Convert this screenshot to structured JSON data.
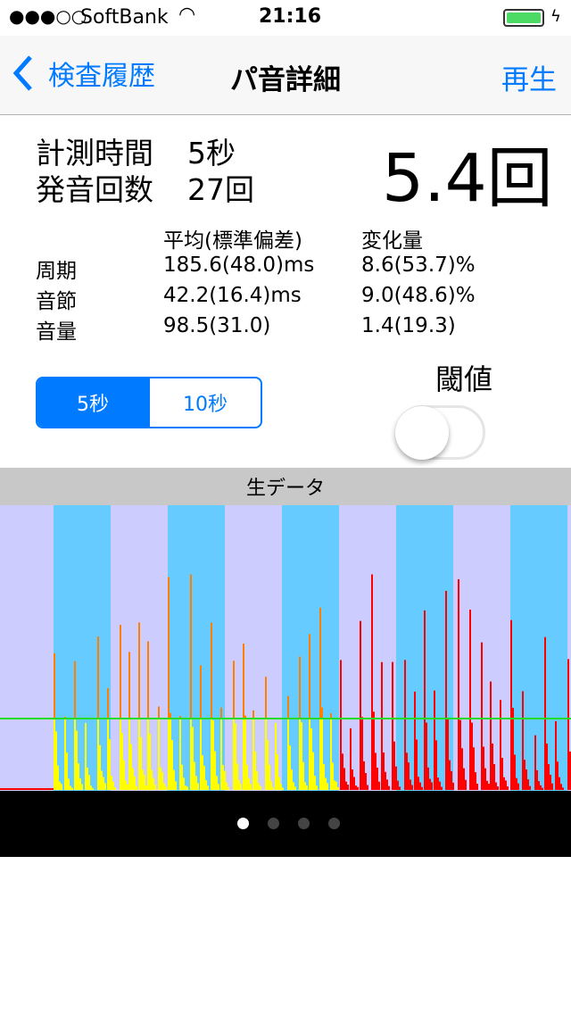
{
  "status_bar": {
    "carrier": "SoftBank",
    "signal_dots": "●●●○○",
    "time": "21:16",
    "battery_level_percent": 100
  },
  "nav": {
    "back_label": "検査履歴",
    "title": "パ音詳細",
    "play_label": "再生"
  },
  "summary": {
    "duration_label": "計測時間",
    "duration_value": "5秒",
    "count_label": "発音回数",
    "count_value": "27回",
    "rate": "5.4回"
  },
  "table": {
    "headers": [
      "",
      "平均(標準偏差)",
      "変化量"
    ],
    "rows": [
      {
        "label": "周期",
        "mean": "185.6(48.0)ms",
        "change": "8.6(53.7)%"
      },
      {
        "label": "音節",
        "mean": "42.2(16.4)ms",
        "change": "9.0(48.6)%"
      },
      {
        "label": "音量",
        "mean": "98.5(31.0)",
        "change": "1.4(19.3)"
      }
    ]
  },
  "segment": {
    "options": [
      "5秒",
      "10秒"
    ],
    "selected": "5秒"
  },
  "threshold": {
    "label": "閾値",
    "on": false
  },
  "graph": {
    "title": "生データ",
    "colors": {
      "band_a": "#ccccff",
      "band_b": "#66ccff",
      "threshold_line": "#22dd22",
      "below": "#ffff00",
      "above": "#ff8000",
      "after": "#ff0000"
    }
  },
  "pager": {
    "pages": 4,
    "current": 1
  },
  "colors": {
    "accent": "#007aff"
  }
}
